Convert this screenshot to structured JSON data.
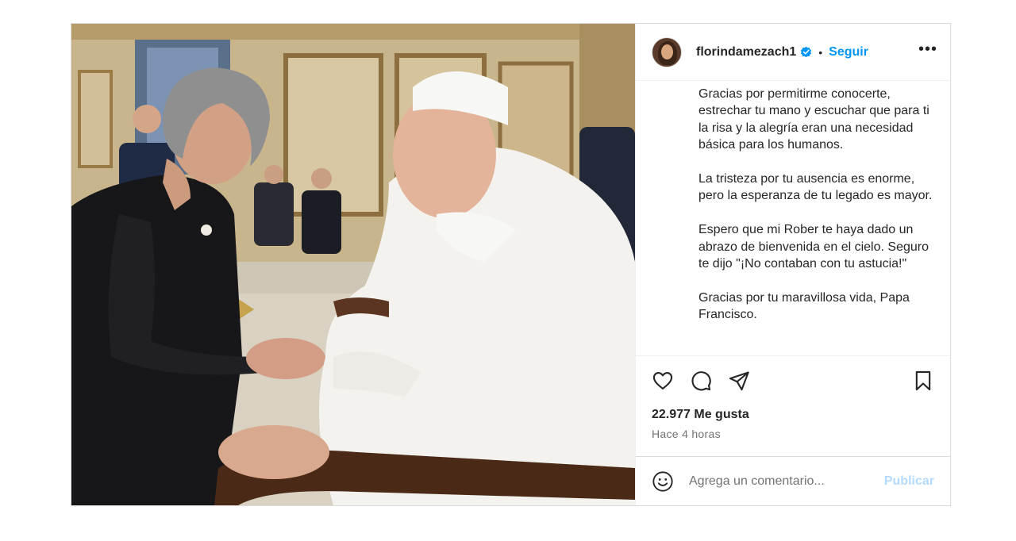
{
  "post": {
    "photo": {
      "description_icon": "photo"
    },
    "header": {
      "username": "florindamezach1",
      "verified_icon": "verified-badge-icon",
      "separator": "•",
      "follow_label": "Seguir",
      "more_label": "•••"
    },
    "caption": {
      "paragraphs": [
        "Gracias por permitirme conocerte, estrechar tu mano y escuchar que para ti la risa y la alegría eran una necesidad básica para los humanos.",
        "La tristeza por tu ausencia es enorme, pero la esperanza de tu legado es mayor.",
        "Espero que mi Rober te haya dado un abrazo de bienvenida en el cielo. Seguro te dijo \"¡No contaban con tu astucia!\"",
        "Gracias por tu maravillosa vida, Papa Francisco."
      ]
    },
    "actions": {
      "like_icon": "heart-icon",
      "comment_icon": "comment-icon",
      "share_icon": "share-icon",
      "save_icon": "bookmark-icon"
    },
    "likes_text": "22.977 Me gusta",
    "time_text": "Hace 4 horas",
    "comment_box": {
      "placeholder": "Agrega un comentario...",
      "publish_label": "Publicar",
      "emoji_icon": "emoji-icon"
    }
  },
  "colors": {
    "accent": "#0095f6",
    "publish_disabled": "#b3dbff",
    "verified": "#0095f6"
  }
}
